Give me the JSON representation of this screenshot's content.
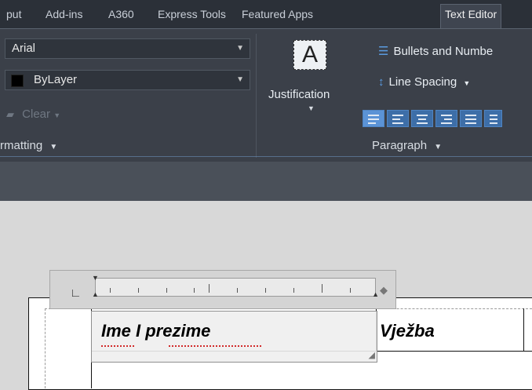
{
  "tabs": [
    {
      "label": "put",
      "active": false
    },
    {
      "label": "Add-ins",
      "active": false
    },
    {
      "label": "A360",
      "active": false
    },
    {
      "label": "Express Tools",
      "active": false
    },
    {
      "label": "Featured Apps",
      "active": false
    },
    {
      "label": "Text Editor",
      "active": true
    }
  ],
  "formatting": {
    "font_value": "Arial",
    "color_value": "ByLayer",
    "clear_label": "Clear",
    "panel_label": "rmatting"
  },
  "paragraph": {
    "justification_label": "Justification",
    "justification_icon_letter": "A",
    "bullets_label": "Bullets and Numbe",
    "line_spacing_label": "Line Spacing",
    "panel_label": "Paragraph"
  },
  "canvas": {
    "cell_1_text": "Ime I prezime",
    "cell_2_text": "Vježba"
  },
  "colors": {
    "ribbon_bg": "#3b4049",
    "tabbar_bg": "#2b3038",
    "accent_blue": "#4f84c2",
    "spellcheck_red": "#d22a2a"
  }
}
